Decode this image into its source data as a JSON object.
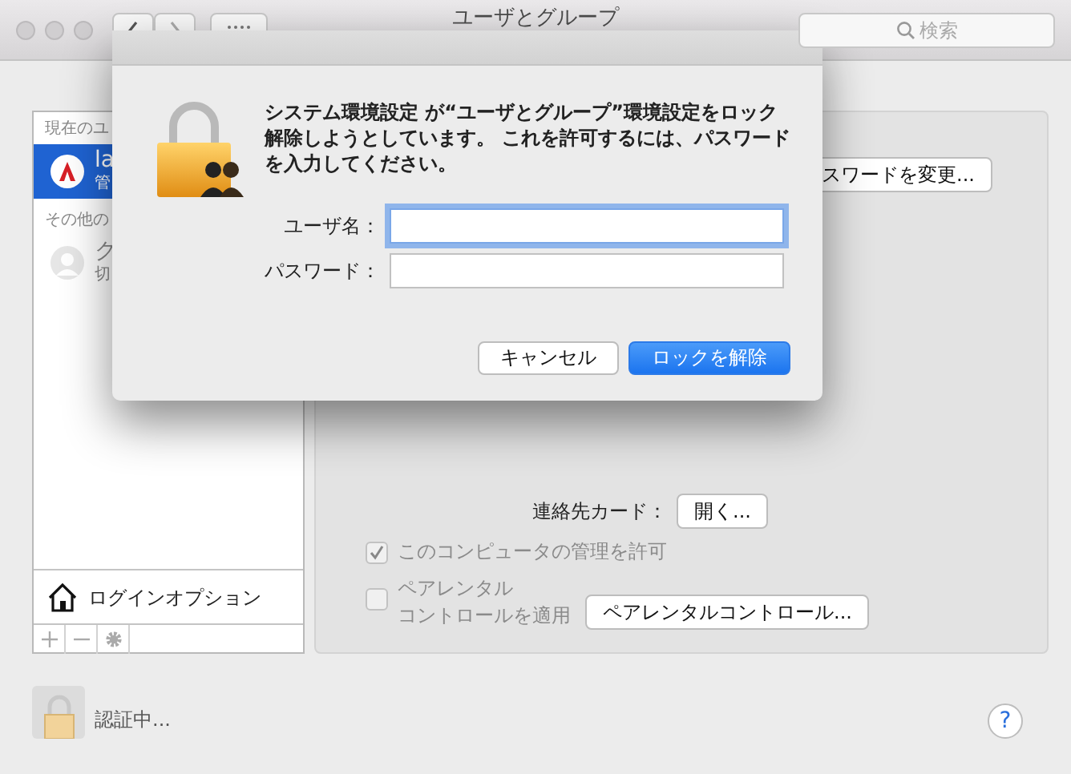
{
  "window": {
    "title": "ユーザとグループ"
  },
  "toolbar": {
    "search": {
      "placeholder": "検索"
    }
  },
  "sidebar": {
    "current_header": "現在のユ",
    "current_users": [
      {
        "name": "la",
        "role": "管",
        "selected": true
      }
    ],
    "other_header": "その他の",
    "other_users": [
      {
        "name": "ク",
        "role": "切",
        "selected": false
      }
    ],
    "login_options": "ログインオプション"
  },
  "panel": {
    "change_password_button": "スワードを変更...",
    "contact_card_label": "連絡先カード：",
    "contact_card_button": "開く...",
    "options": [
      {
        "label": "このコンピュータの管理を許可",
        "checked": true,
        "disabled": true
      },
      {
        "label_lines": [
          "ペアレンタル",
          "コントロールを適用"
        ],
        "checked": false,
        "disabled": true
      }
    ],
    "parental_button": "ペアレンタルコントロール..."
  },
  "footer": {
    "status": "認証中...",
    "help": "?"
  },
  "dialog": {
    "message": "システム環境設定 が“ユーザとグループ”環境設定をロック解除しようとしています。 これを許可するには、パスワードを入力してください。",
    "fields": [
      {
        "label": "ユーザ名：",
        "focused": true
      },
      {
        "label": "パスワード：",
        "focused": false
      }
    ],
    "buttons": [
      {
        "label": "キャンセル",
        "default": false
      },
      {
        "label": "ロックを解除",
        "default": true
      }
    ]
  }
}
